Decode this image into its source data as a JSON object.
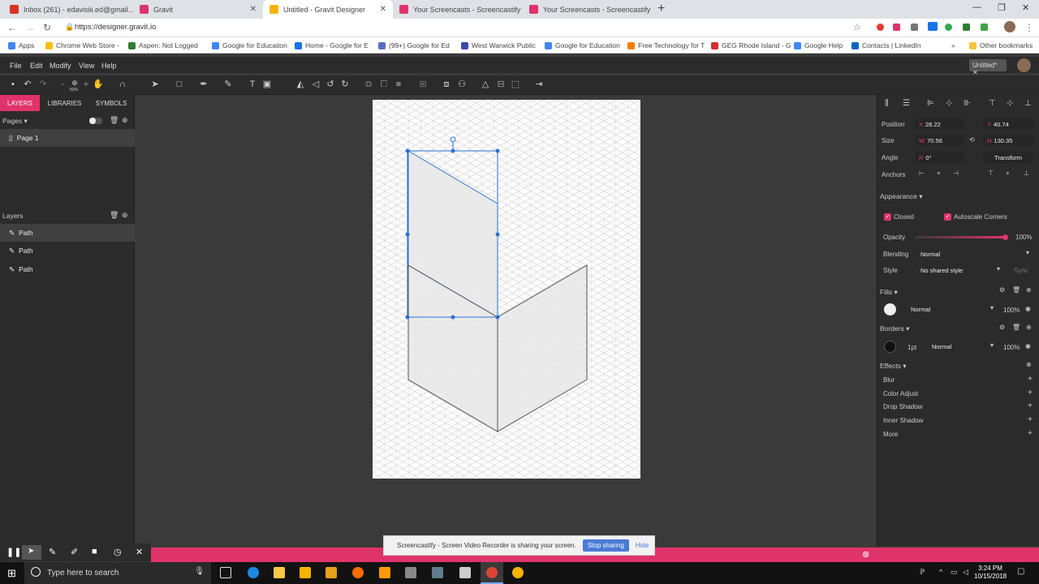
{
  "browser": {
    "tabs": [
      {
        "title": "Inbox (261) - edavisiii.ed@gmail...",
        "active": false,
        "favicon_color": "#d93025"
      },
      {
        "title": "Gravit",
        "active": false,
        "favicon_color": "#e0336c"
      },
      {
        "title": "Untitled - Gravit Designer",
        "active": true,
        "favicon_color": "#f5b400"
      },
      {
        "title": "Your Screencasts - Screencastify",
        "active": false,
        "favicon_color": "#e0336c"
      },
      {
        "title": "Your Screencasts - Screencastify",
        "active": false,
        "favicon_color": "#e0336c"
      }
    ],
    "url": "https://designer.gravit.io",
    "bookmarks": [
      "Apps",
      "Chrome Web Store -",
      "Aspen: Not Logged",
      "Google for Education",
      "Home - Google for E",
      "(99+) Google for Ed",
      "West Warwick Public",
      "Google for Education",
      "Free Technology for T",
      "GEG Rhode Island - G",
      "Google Help",
      "Contacts | LinkedIn",
      "Other bookmarks"
    ]
  },
  "app": {
    "menu": [
      "File",
      "Edit",
      "Modify",
      "View",
      "Help"
    ],
    "doc_tab": "Untitled*",
    "zoom": "83%"
  },
  "left_panel": {
    "tabs": [
      "LAYERS",
      "LIBRARIES",
      "SYMBOLS"
    ],
    "pages_label": "Pages",
    "pages": [
      "Page 1"
    ],
    "layers_label": "Layers",
    "layers": [
      "Path",
      "Path",
      "Path"
    ]
  },
  "right_panel": {
    "position_label": "Position",
    "x": "28.22",
    "y": "40.74",
    "size_label": "Size",
    "w": "70.56",
    "h": "130.35",
    "angle_label": "Angle",
    "angle": "0°",
    "transform_label": "Transform",
    "anchors_label": "Anchors",
    "appearance_label": "Appearance",
    "closed_label": "Closed",
    "autoscale_label": "Autoscale Corners",
    "opacity_label": "Opacity",
    "opacity": "100%",
    "blending_label": "Blending",
    "blending": "Normal",
    "style_label": "Style",
    "style": "No shared style",
    "sync_label": "Sync",
    "fills_label": "Fills",
    "fill_mode": "Normal",
    "fill_opacity": "100%",
    "borders_label": "Borders",
    "border_width": "1pt",
    "border_mode": "Normal",
    "border_opacity": "100%",
    "effects_label": "Effects",
    "effects": [
      "Blur",
      "Color Adjust",
      "Drop Shadow",
      "Inner Shadow",
      "More"
    ]
  },
  "screencastify": {
    "notice": "Screencastify - Screen Video Recorder is sharing your screen.",
    "stop": "Stop sharing",
    "hide": "Hide"
  },
  "taskbar": {
    "search_placeholder": "Type here to search",
    "time": "3:24 PM",
    "date": "10/15/2018"
  },
  "colors": {
    "accent": "#e0336c",
    "selection": "#2b6fd1"
  }
}
